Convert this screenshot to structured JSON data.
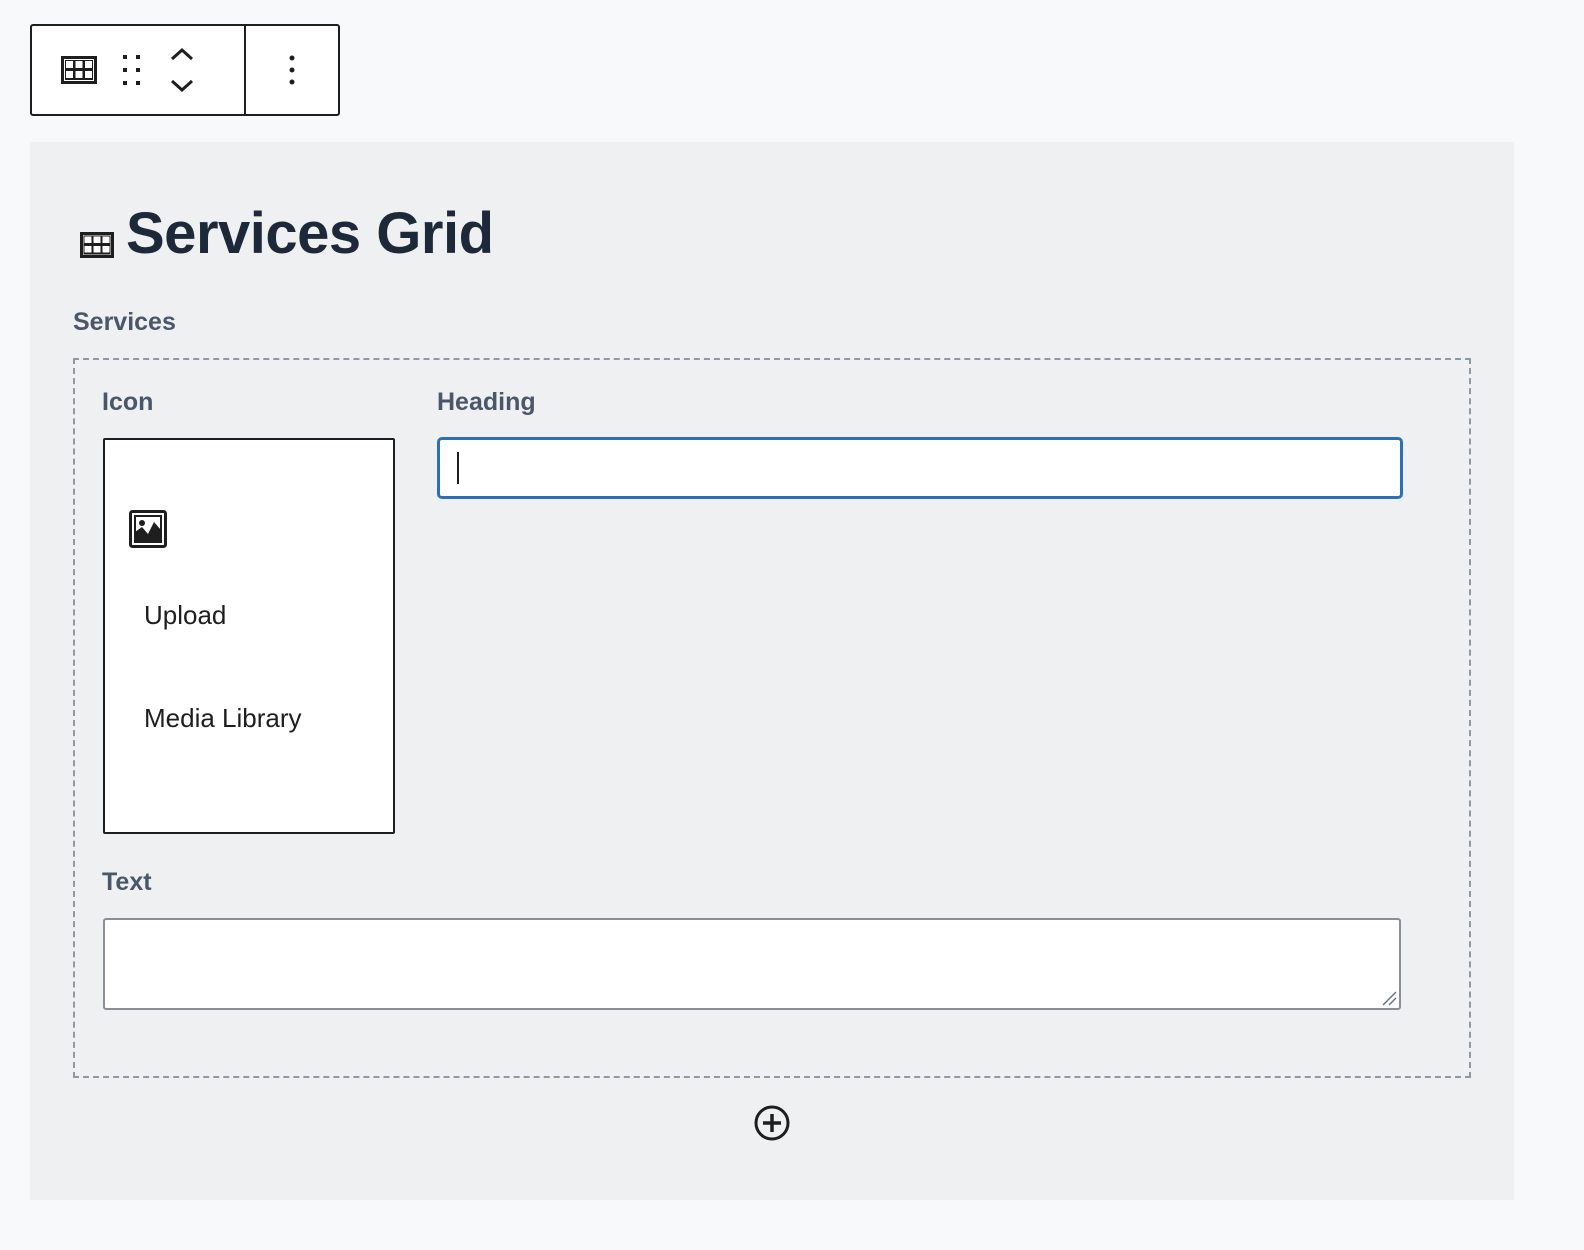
{
  "toolbar": {
    "block_type_icon": "grid-icon",
    "drag_icon": "drag-handle-icon",
    "move_up_icon": "chevron-up-icon",
    "move_down_icon": "chevron-down-icon",
    "options_icon": "more-vertical-icon"
  },
  "block": {
    "title_icon": "grid-icon",
    "title": "Services Grid",
    "background": "#eef0f2"
  },
  "services": {
    "label": "Services",
    "item": {
      "icon_field": {
        "label": "Icon",
        "placeholder_icon": "image-icon",
        "upload_label": "Upload",
        "media_library_label": "Media Library"
      },
      "heading_field": {
        "label": "Heading",
        "value": "",
        "focus_color": "#2f6fb6"
      },
      "text_field": {
        "label": "Text",
        "value": ""
      }
    },
    "add_icon": "plus-circle-icon"
  }
}
